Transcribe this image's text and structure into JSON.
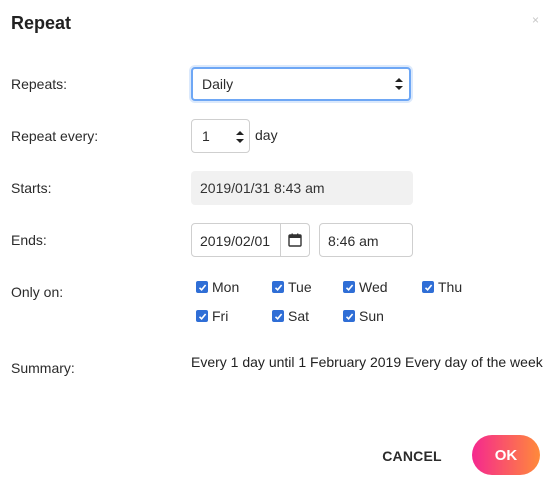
{
  "dialog": {
    "title": "Repeat",
    "close_glyph": "×"
  },
  "form": {
    "repeats": {
      "label": "Repeats:",
      "value": "Daily"
    },
    "repeat_every": {
      "label": "Repeat every:",
      "value": "1",
      "unit": "day"
    },
    "starts": {
      "label": "Starts:",
      "value": "2019/01/31 8:43 am"
    },
    "ends": {
      "label": "Ends:",
      "date": "2019/02/01",
      "time": "8:46 am",
      "calendar_icon": "calendar-icon"
    },
    "only_on": {
      "label": "Only on:",
      "days": [
        {
          "label": "Mon",
          "checked": true
        },
        {
          "label": "Tue",
          "checked": true
        },
        {
          "label": "Wed",
          "checked": true
        },
        {
          "label": "Thu",
          "checked": true
        },
        {
          "label": "Fri",
          "checked": true
        },
        {
          "label": "Sat",
          "checked": true
        },
        {
          "label": "Sun",
          "checked": true
        }
      ]
    },
    "summary": {
      "label": "Summary:",
      "value": "Every 1 day until 1 February 2019 Every day of the week"
    }
  },
  "actions": {
    "cancel_label": "CANCEL",
    "ok_label": "OK"
  },
  "colors": {
    "focus_ring": "#6ea7f5",
    "checkbox": "#2f6ed6",
    "ok_gradient_start": "#f5288f",
    "ok_gradient_end": "#ff8a3a"
  }
}
